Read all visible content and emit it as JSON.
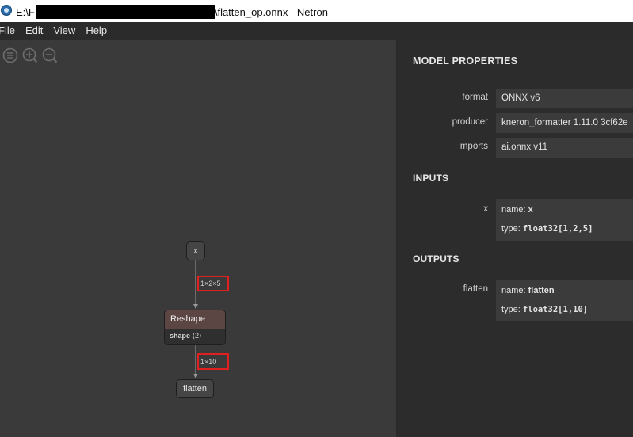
{
  "window": {
    "title_prefix": "E:\\F",
    "title_suffix": "\\flatten_op.onnx - Netron"
  },
  "menu": [
    "File",
    "Edit",
    "View",
    "Help"
  ],
  "toolbar": {
    "icons": [
      "sidebar-toggle-icon",
      "zoom-in-icon",
      "zoom-out-icon"
    ]
  },
  "graph": {
    "input_node": "x",
    "op_node": {
      "name": "Reshape",
      "attr_name": "shape",
      "attr_value": "⟨2⟩"
    },
    "output_node": "flatten",
    "edge_1_label": "1×2×5",
    "edge_2_label": "1×10"
  },
  "properties": {
    "header": "MODEL PROPERTIES",
    "rows": [
      {
        "label": "format",
        "value": "ONNX v6"
      },
      {
        "label": "producer",
        "value": "kneron_formatter 1.11.0 3cf62e"
      },
      {
        "label": "imports",
        "value": "ai.onnx v11"
      }
    ],
    "inputs_header": "INPUTS",
    "input": {
      "label": "x",
      "name_key": "name:",
      "name_value": "x",
      "type_key": "type:",
      "type_value": "float32[1,2,5]"
    },
    "outputs_header": "OUTPUTS",
    "output": {
      "label": "flatten",
      "name_key": "name:",
      "name_value": "flatten",
      "type_key": "type:",
      "type_value": "float32[1,10]"
    }
  },
  "colors": {
    "op_header": "#5c4644",
    "highlight": "#e01f1f"
  }
}
